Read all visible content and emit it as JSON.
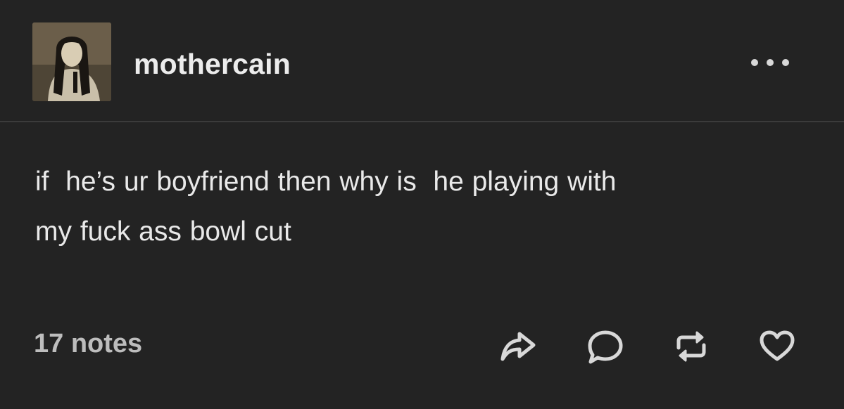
{
  "post": {
    "username": "mothercain",
    "body_line1": "if  he’s ur boyfriend then why is  he playing with",
    "body_line2": "my fuck ass bowl cut",
    "notes": "17 notes"
  },
  "icons": {
    "more": "more-options-icon",
    "share": "share-icon",
    "reply": "reply-icon",
    "reblog": "reblog-icon",
    "like": "heart-icon"
  },
  "colors": {
    "background": "#232323",
    "text": "#e9e9e9",
    "muted": "#bdbdbd",
    "icon": "#d8d8d8"
  }
}
